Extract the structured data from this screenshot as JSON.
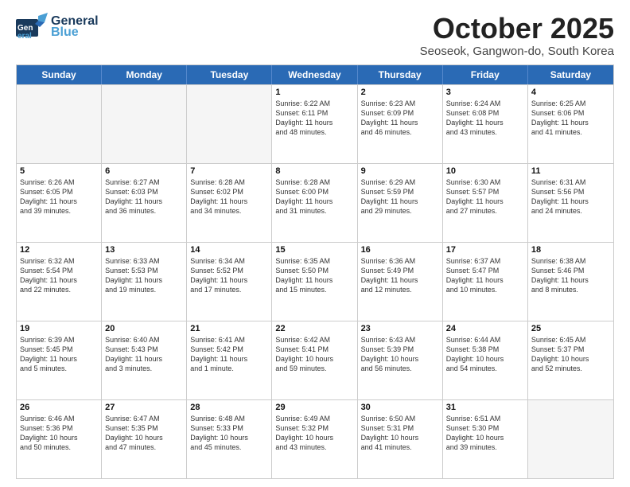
{
  "header": {
    "logo_general": "General",
    "logo_blue": "Blue",
    "month_title": "October 2025",
    "location": "Seoseok, Gangwon-do, South Korea"
  },
  "weekdays": [
    "Sunday",
    "Monday",
    "Tuesday",
    "Wednesday",
    "Thursday",
    "Friday",
    "Saturday"
  ],
  "rows": [
    [
      {
        "day": "",
        "info": ""
      },
      {
        "day": "",
        "info": ""
      },
      {
        "day": "",
        "info": ""
      },
      {
        "day": "1",
        "info": "Sunrise: 6:22 AM\nSunset: 6:11 PM\nDaylight: 11 hours\nand 48 minutes."
      },
      {
        "day": "2",
        "info": "Sunrise: 6:23 AM\nSunset: 6:09 PM\nDaylight: 11 hours\nand 46 minutes."
      },
      {
        "day": "3",
        "info": "Sunrise: 6:24 AM\nSunset: 6:08 PM\nDaylight: 11 hours\nand 43 minutes."
      },
      {
        "day": "4",
        "info": "Sunrise: 6:25 AM\nSunset: 6:06 PM\nDaylight: 11 hours\nand 41 minutes."
      }
    ],
    [
      {
        "day": "5",
        "info": "Sunrise: 6:26 AM\nSunset: 6:05 PM\nDaylight: 11 hours\nand 39 minutes."
      },
      {
        "day": "6",
        "info": "Sunrise: 6:27 AM\nSunset: 6:03 PM\nDaylight: 11 hours\nand 36 minutes."
      },
      {
        "day": "7",
        "info": "Sunrise: 6:28 AM\nSunset: 6:02 PM\nDaylight: 11 hours\nand 34 minutes."
      },
      {
        "day": "8",
        "info": "Sunrise: 6:28 AM\nSunset: 6:00 PM\nDaylight: 11 hours\nand 31 minutes."
      },
      {
        "day": "9",
        "info": "Sunrise: 6:29 AM\nSunset: 5:59 PM\nDaylight: 11 hours\nand 29 minutes."
      },
      {
        "day": "10",
        "info": "Sunrise: 6:30 AM\nSunset: 5:57 PM\nDaylight: 11 hours\nand 27 minutes."
      },
      {
        "day": "11",
        "info": "Sunrise: 6:31 AM\nSunset: 5:56 PM\nDaylight: 11 hours\nand 24 minutes."
      }
    ],
    [
      {
        "day": "12",
        "info": "Sunrise: 6:32 AM\nSunset: 5:54 PM\nDaylight: 11 hours\nand 22 minutes."
      },
      {
        "day": "13",
        "info": "Sunrise: 6:33 AM\nSunset: 5:53 PM\nDaylight: 11 hours\nand 19 minutes."
      },
      {
        "day": "14",
        "info": "Sunrise: 6:34 AM\nSunset: 5:52 PM\nDaylight: 11 hours\nand 17 minutes."
      },
      {
        "day": "15",
        "info": "Sunrise: 6:35 AM\nSunset: 5:50 PM\nDaylight: 11 hours\nand 15 minutes."
      },
      {
        "day": "16",
        "info": "Sunrise: 6:36 AM\nSunset: 5:49 PM\nDaylight: 11 hours\nand 12 minutes."
      },
      {
        "day": "17",
        "info": "Sunrise: 6:37 AM\nSunset: 5:47 PM\nDaylight: 11 hours\nand 10 minutes."
      },
      {
        "day": "18",
        "info": "Sunrise: 6:38 AM\nSunset: 5:46 PM\nDaylight: 11 hours\nand 8 minutes."
      }
    ],
    [
      {
        "day": "19",
        "info": "Sunrise: 6:39 AM\nSunset: 5:45 PM\nDaylight: 11 hours\nand 5 minutes."
      },
      {
        "day": "20",
        "info": "Sunrise: 6:40 AM\nSunset: 5:43 PM\nDaylight: 11 hours\nand 3 minutes."
      },
      {
        "day": "21",
        "info": "Sunrise: 6:41 AM\nSunset: 5:42 PM\nDaylight: 11 hours\nand 1 minute."
      },
      {
        "day": "22",
        "info": "Sunrise: 6:42 AM\nSunset: 5:41 PM\nDaylight: 10 hours\nand 59 minutes."
      },
      {
        "day": "23",
        "info": "Sunrise: 6:43 AM\nSunset: 5:39 PM\nDaylight: 10 hours\nand 56 minutes."
      },
      {
        "day": "24",
        "info": "Sunrise: 6:44 AM\nSunset: 5:38 PM\nDaylight: 10 hours\nand 54 minutes."
      },
      {
        "day": "25",
        "info": "Sunrise: 6:45 AM\nSunset: 5:37 PM\nDaylight: 10 hours\nand 52 minutes."
      }
    ],
    [
      {
        "day": "26",
        "info": "Sunrise: 6:46 AM\nSunset: 5:36 PM\nDaylight: 10 hours\nand 50 minutes."
      },
      {
        "day": "27",
        "info": "Sunrise: 6:47 AM\nSunset: 5:35 PM\nDaylight: 10 hours\nand 47 minutes."
      },
      {
        "day": "28",
        "info": "Sunrise: 6:48 AM\nSunset: 5:33 PM\nDaylight: 10 hours\nand 45 minutes."
      },
      {
        "day": "29",
        "info": "Sunrise: 6:49 AM\nSunset: 5:32 PM\nDaylight: 10 hours\nand 43 minutes."
      },
      {
        "day": "30",
        "info": "Sunrise: 6:50 AM\nSunset: 5:31 PM\nDaylight: 10 hours\nand 41 minutes."
      },
      {
        "day": "31",
        "info": "Sunrise: 6:51 AM\nSunset: 5:30 PM\nDaylight: 10 hours\nand 39 minutes."
      },
      {
        "day": "",
        "info": ""
      }
    ]
  ]
}
